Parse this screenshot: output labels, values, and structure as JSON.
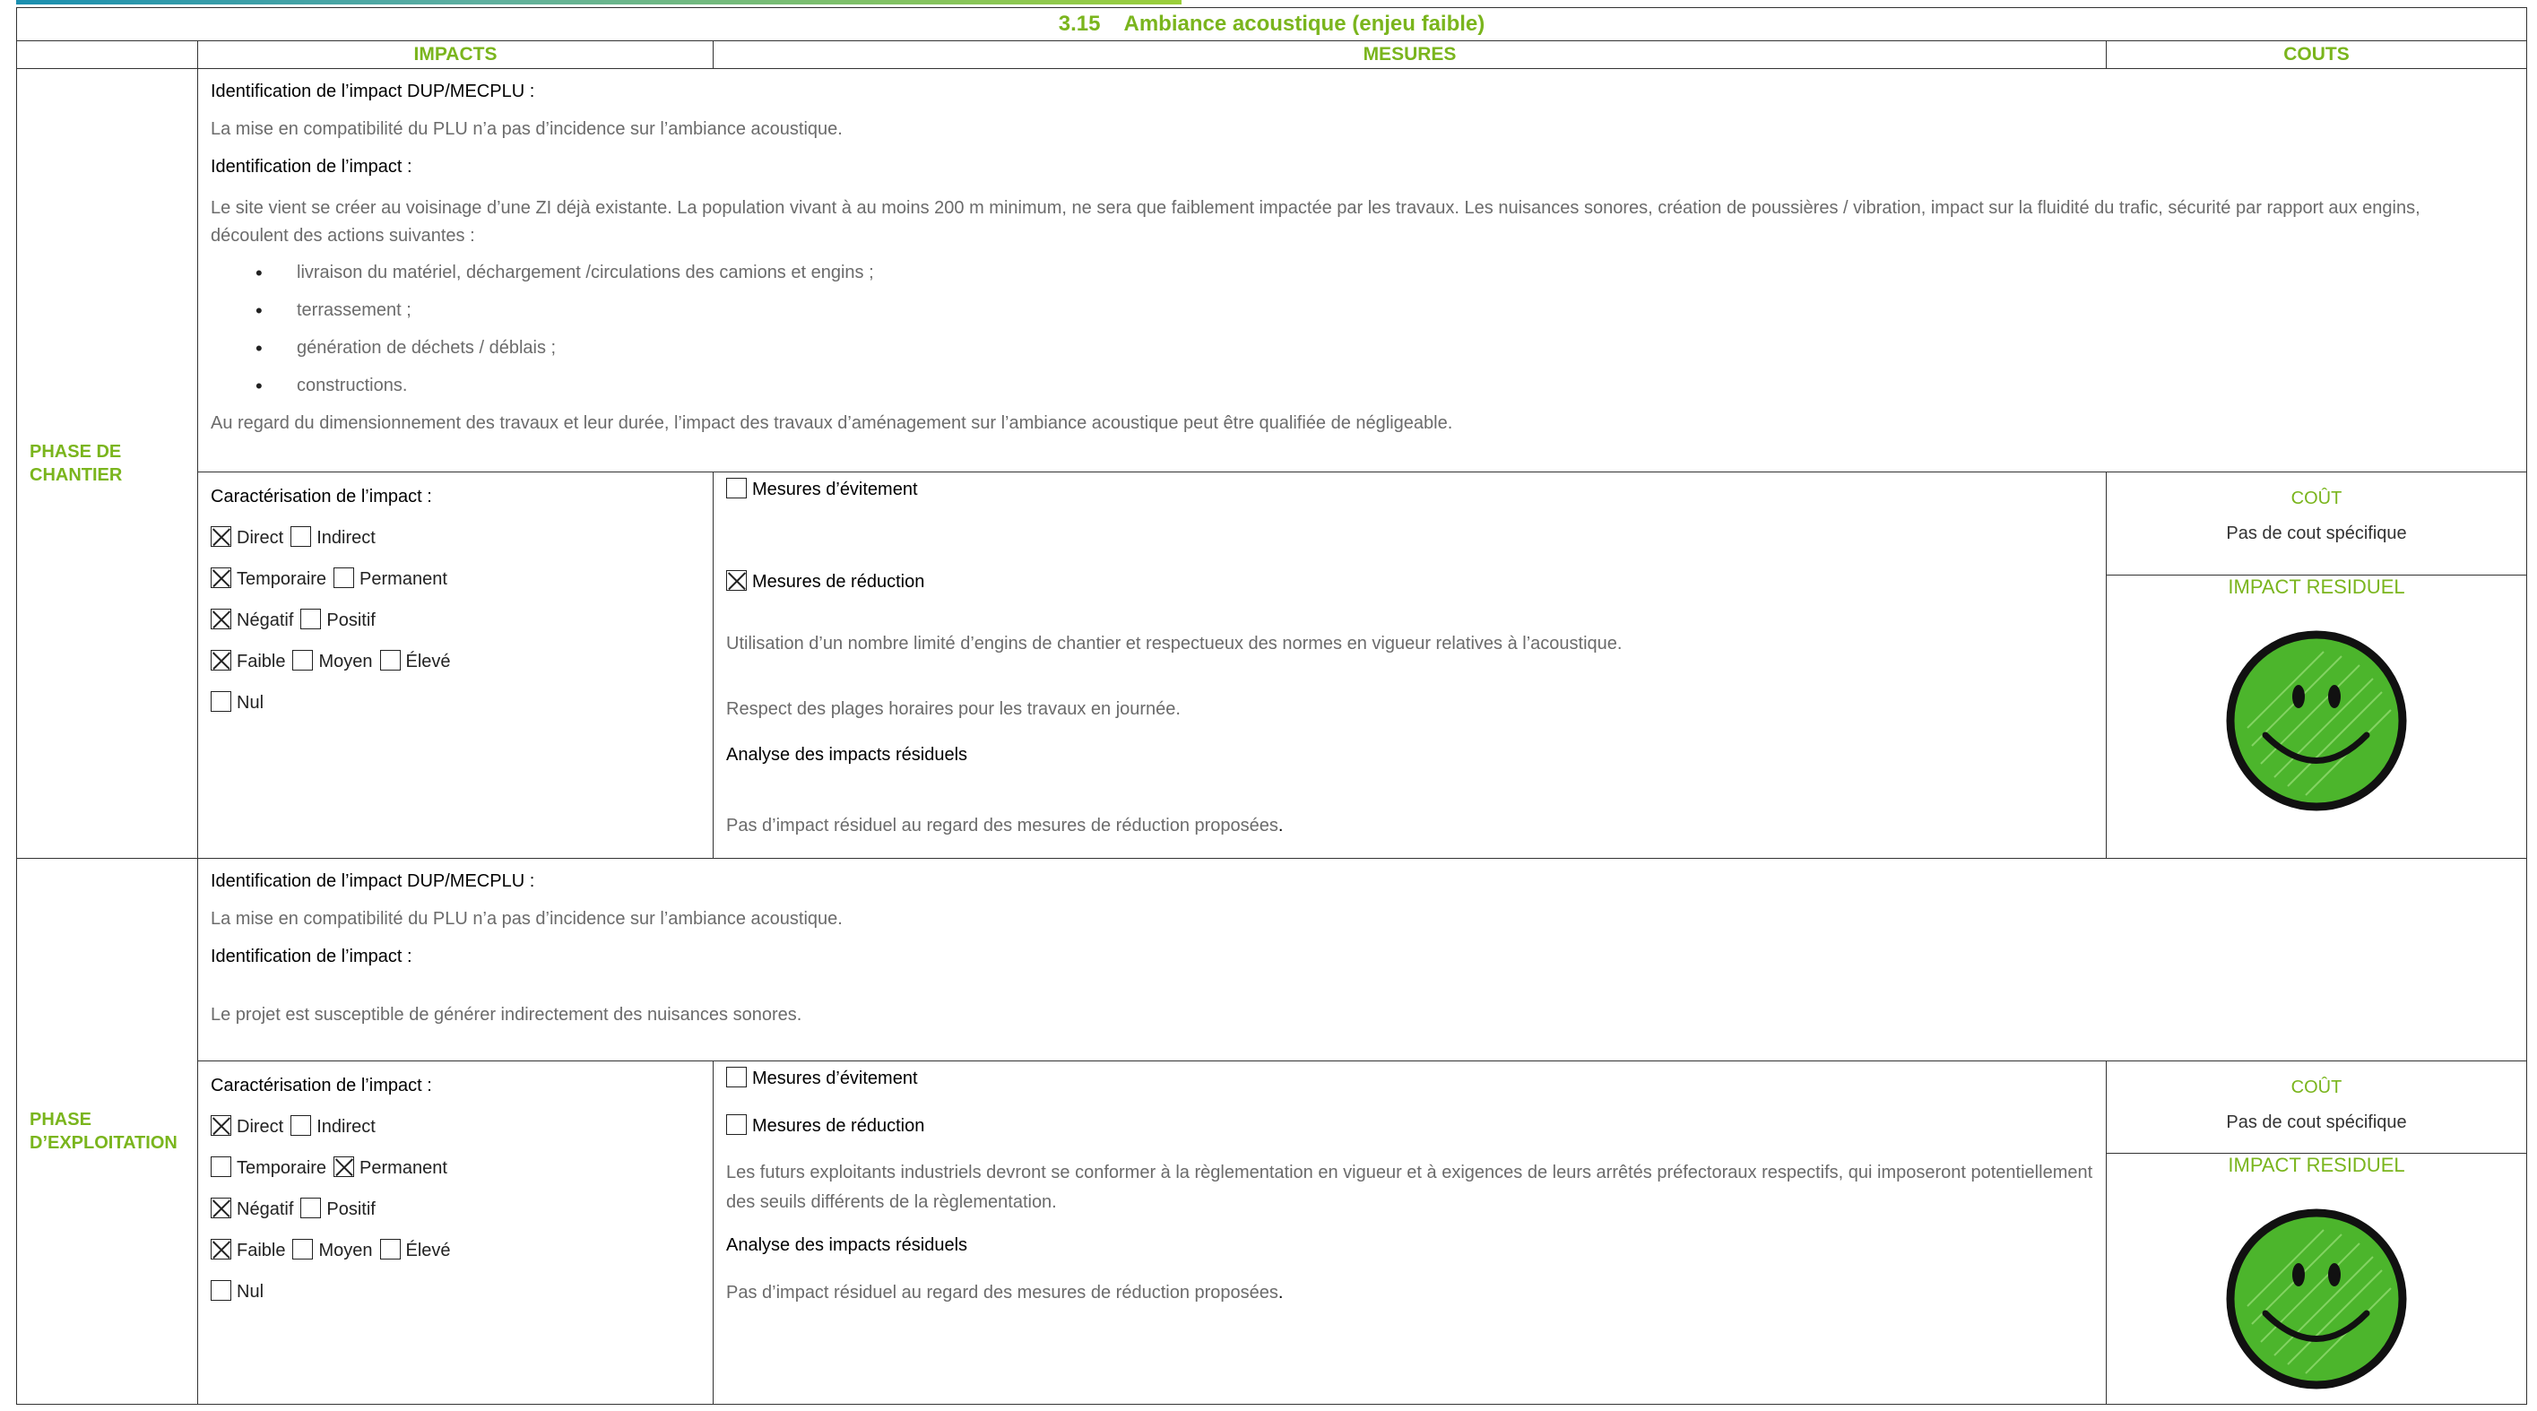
{
  "title_number": "3.15",
  "title": "Ambiance acoustique (enjeu faible)",
  "headers": {
    "impacts": "IMPACTS",
    "mesures": "MESURES",
    "couts": "COUTS"
  },
  "chantier": {
    "phase": "PHASE DE CHANTIER",
    "id_dup_label": "Identification de l’impact DUP/MECPLU :",
    "id_dup_text": "La mise en compatibilité du PLU n’a pas d’incidence sur l’ambiance acoustique.",
    "id_label": "Identification de l’impact :",
    "id_text": "Le site vient se créer au voisinage d’une ZI déjà existante. La population vivant à au moins 200 m minimum, ne sera que faiblement impactée par les travaux. Les nuisances sonores, création de poussières / vibration, impact sur la fluidité du trafic, sécurité par rapport aux engins, découlent des actions suivantes :",
    "bullets": [
      "livraison du matériel, déchargement /circulations des camions et engins ;",
      "terrassement ;",
      "génération de déchets / déblais ;",
      "constructions."
    ],
    "conclusion": "Au regard du dimensionnement des travaux et leur durée, l’impact des travaux d’aménagement sur l’ambiance acoustique peut être qualifiée de négligeable.",
    "carac_label": "Caractérisation de l’impact :",
    "carac": {
      "direct": "Direct",
      "indirect": "Indirect",
      "temporaire": "Temporaire",
      "permanent": "Permanent",
      "negatif": "Négatif",
      "positif": "Positif",
      "faible": "Faible",
      "moyen": "Moyen",
      "eleve": "Élevé",
      "nul": "Nul"
    },
    "evitement_label": "Mesures d’évitement",
    "reduction_label": "Mesures de réduction",
    "reduction_items": [
      "Utilisation d’un nombre limité d’engins de chantier et respectueux des normes en vigueur relatives à l’acoustique.",
      "Respect des plages horaires pour les travaux en journée."
    ],
    "analyse_label": "Analyse des impacts résiduels",
    "analyse_text": "Pas d’impact résiduel au regard des mesures de réduction proposées",
    "cout_label": "COÛT",
    "cout_value": "Pas de cout spécifique",
    "resid_label": "IMPACT RESIDUEL"
  },
  "exploitation": {
    "phase": "PHASE D’EXPLOITATION",
    "id_dup_label": "Identification de l’impact DUP/MECPLU :",
    "id_dup_text": "La mise en compatibilité du PLU n’a pas d’incidence sur l’ambiance acoustique.",
    "id_label": "Identification de l’impact :",
    "id_text": "Le projet est susceptible de générer indirectement des nuisances sonores.",
    "carac_label": "Caractérisation de l’impact :",
    "carac": {
      "direct": "Direct",
      "indirect": "Indirect",
      "temporaire": "Temporaire",
      "permanent": "Permanent",
      "negatif": "Négatif",
      "positif": "Positif",
      "faible": "Faible",
      "moyen": "Moyen",
      "eleve": "Élevé",
      "nul": "Nul"
    },
    "evitement_label": "Mesures d’évitement",
    "reduction_label": "Mesures de réduction",
    "reduction_text": "Les futurs exploitants industriels devront se conformer à la règlementation en vigueur et à exigences de leurs arrêtés préfectoraux respectifs, qui imposeront potentiellement des seuils différents de la règlementation.",
    "analyse_label": "Analyse des impacts résiduels",
    "analyse_text": "Pas d’impact résiduel au regard des mesures de réduction proposées",
    "cout_label": "COÛT",
    "cout_value": "Pas de cout spécifique",
    "resid_label": "IMPACT RESIDUEL"
  },
  "colors": {
    "accent_green": "#7ab51d",
    "smiley_green": "#4cb52c"
  },
  "icons": [
    "checkbox-checked-icon",
    "checkbox-empty-icon",
    "smiley-face-icon"
  ]
}
